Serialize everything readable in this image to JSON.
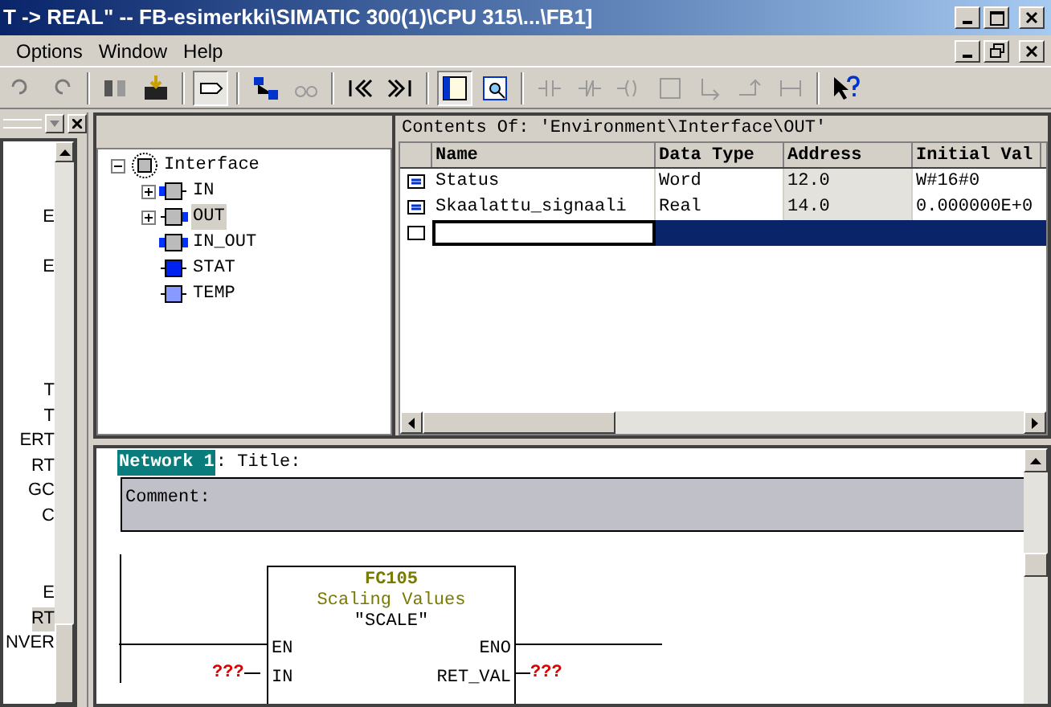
{
  "window": {
    "title": "T -> REAL\" -- FB-esimerkki\\SIMATIC 300(1)\\CPU 315\\...\\FB1]"
  },
  "menu": [
    "Options",
    "Window",
    "Help"
  ],
  "left_panel": {
    "items": [
      {
        "label": "E",
        "selected": false
      },
      {
        "label": "E",
        "selected": false
      },
      {
        "label": "T",
        "selected": false
      },
      {
        "label": "T",
        "selected": false
      },
      {
        "label": "ERT",
        "selected": false
      },
      {
        "label": "RT",
        "selected": false
      },
      {
        "label": "GC",
        "selected": false
      },
      {
        "label": "C",
        "selected": false
      },
      {
        "label": "E",
        "selected": false
      },
      {
        "label": "RT",
        "selected": true
      },
      {
        "label": "NVER",
        "selected": false
      }
    ]
  },
  "tree": {
    "label": "Interface",
    "expanded": true,
    "children": [
      {
        "label": "IN",
        "kind": "in",
        "expandable": true,
        "selected": false
      },
      {
        "label": "OUT",
        "kind": "out",
        "expandable": true,
        "selected": true
      },
      {
        "label": "IN_OUT",
        "kind": "inout",
        "expandable": false,
        "selected": false
      },
      {
        "label": "STAT",
        "kind": "stat",
        "expandable": false,
        "selected": false
      },
      {
        "label": "TEMP",
        "kind": "temp",
        "expandable": false,
        "selected": false
      }
    ]
  },
  "table": {
    "caption": "Contents Of: 'Environment\\Interface\\OUT'",
    "columns": [
      "Name",
      "Data Type",
      "Address",
      "Initial Val"
    ],
    "rows": [
      {
        "kind": "declaration",
        "selected": false,
        "cells": [
          "Status",
          "Word",
          "12.0",
          "W#16#0"
        ]
      },
      {
        "kind": "declaration",
        "selected": false,
        "cells": [
          "Skaalattu_signaali",
          "Real",
          "14.0",
          "0.000000E+0"
        ]
      },
      {
        "kind": "new",
        "selected": true,
        "cells": []
      }
    ]
  },
  "network": {
    "label": "Network 1",
    "title": ": Title:",
    "comment": "Comment:",
    "block": {
      "number": "FC105",
      "description": "Scaling Values",
      "symbol": "\"SCALE\"",
      "inputs": [
        "EN",
        "IN"
      ],
      "outputs": [
        "ENO",
        "RET_VAL"
      ]
    },
    "unconnected": [
      "???",
      "???"
    ]
  }
}
